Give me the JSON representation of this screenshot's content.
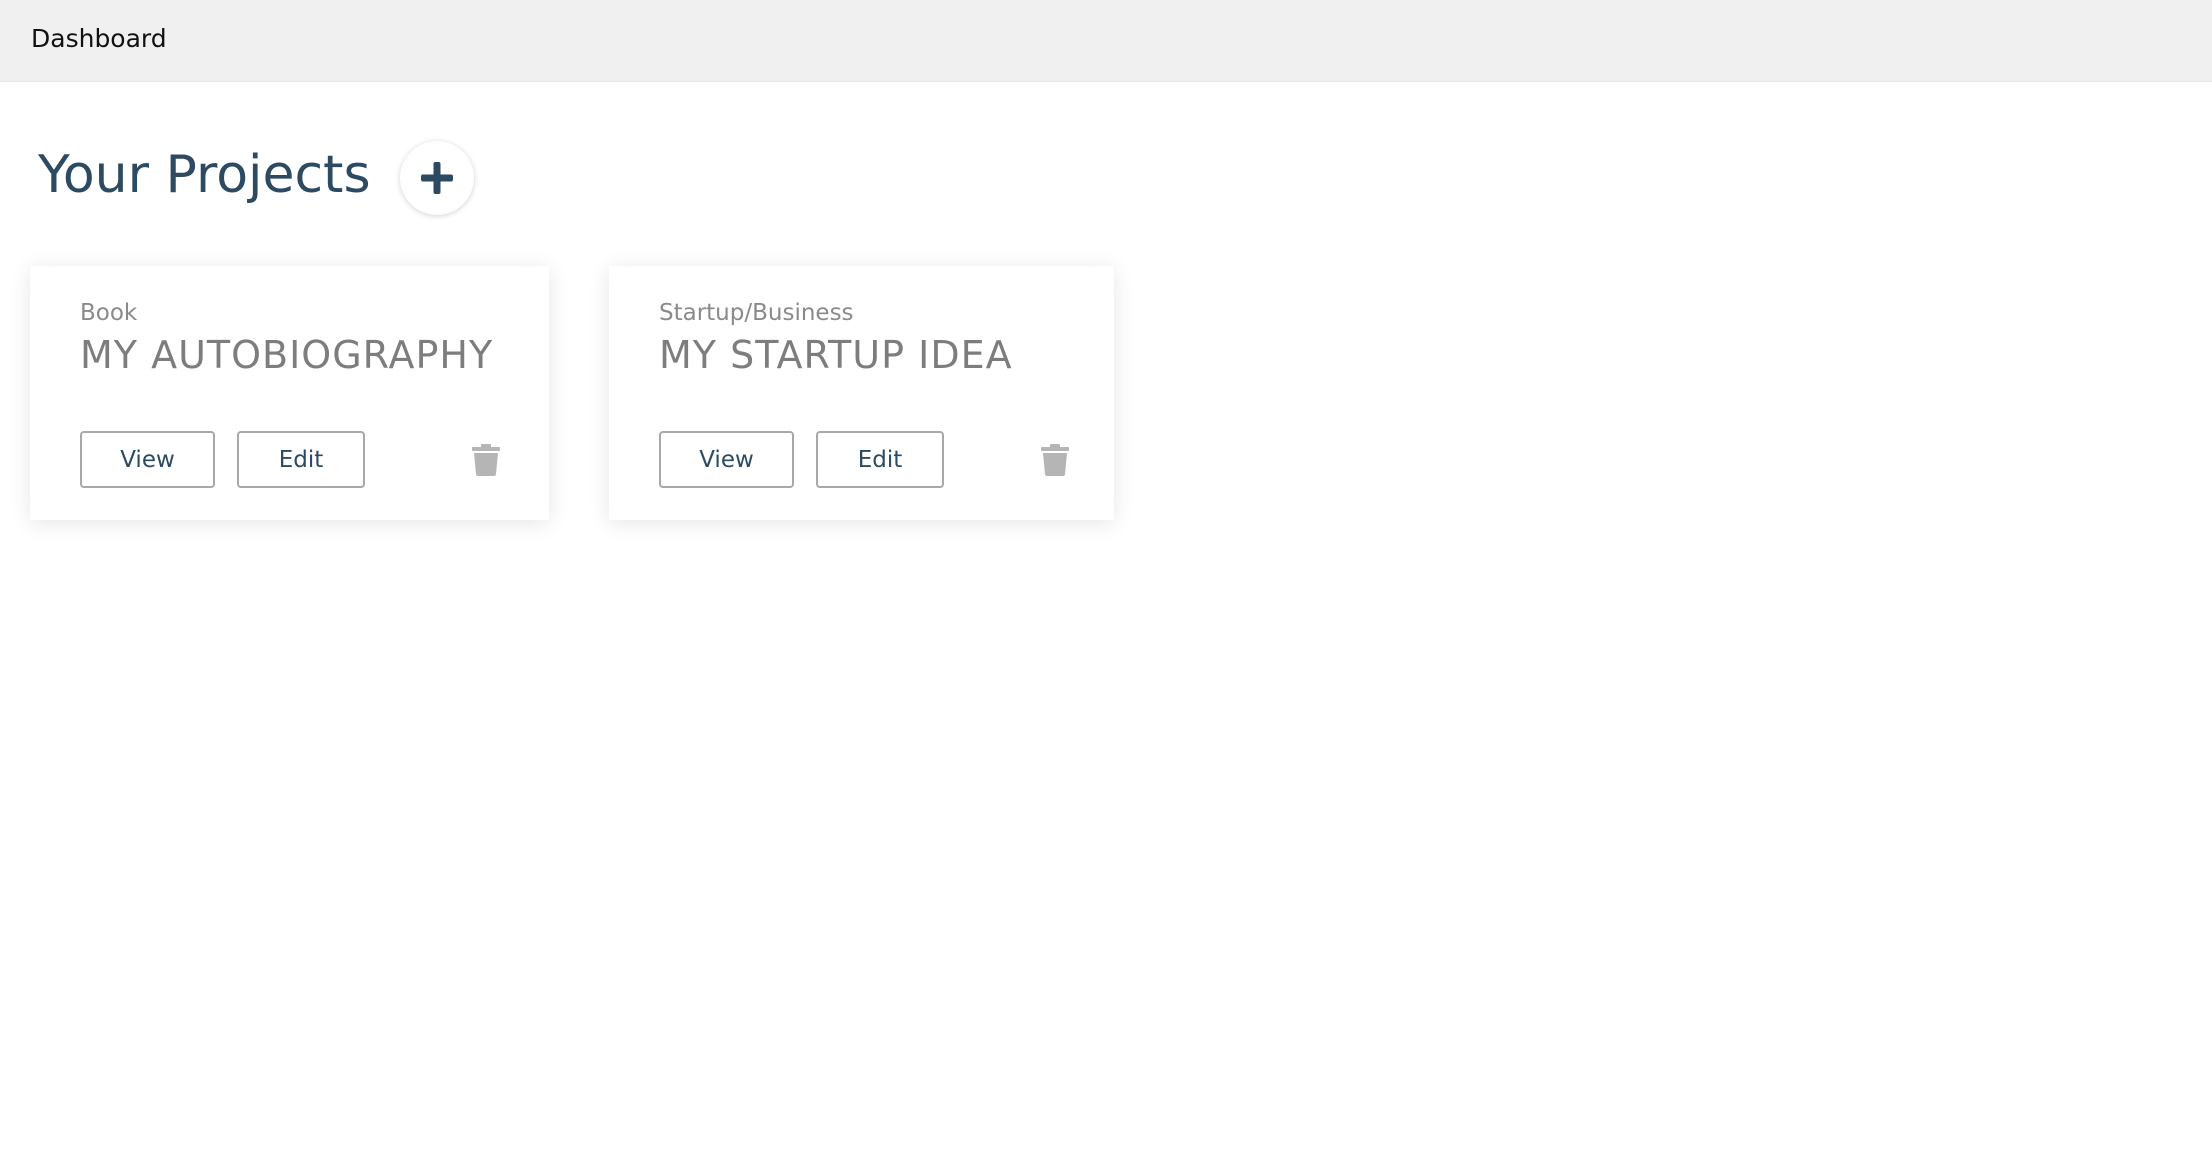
{
  "header": {
    "title": "Dashboard"
  },
  "main": {
    "heading": "Your Projects",
    "add_icon": "plus-icon",
    "projects": [
      {
        "category": "Book",
        "title": "MY AUTOBIOGRAPHY",
        "view_label": "View",
        "edit_label": "Edit",
        "delete_icon": "trash-icon"
      },
      {
        "category": "Startup/Business",
        "title": "MY STARTUP IDEA",
        "view_label": "View",
        "edit_label": "Edit",
        "delete_icon": "trash-icon"
      }
    ]
  },
  "colors": {
    "heading": "#2c4a62",
    "header_bg": "#f0f0f0",
    "muted_text": "#7d7d7d",
    "icon_gray": "#b5b5b5"
  }
}
